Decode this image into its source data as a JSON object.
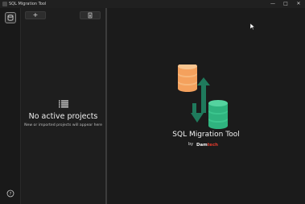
{
  "window": {
    "title": "SQL Migration Tool",
    "controls": {
      "minimize": "—",
      "maximize": "□",
      "close": "✕"
    }
  },
  "rail": {
    "top_icon": "projects-icon",
    "bottom_icon": "help-icon"
  },
  "panel": {
    "add_label": "+",
    "import_icon": "import-icon",
    "empty_icon": "list-icon",
    "empty_title": "No active projects",
    "empty_subtitle": "New or imported projects will appear here"
  },
  "main": {
    "product_name": "SQL Migration Tool",
    "by": "by",
    "brand_part1": "Dam",
    "brand_part2": "tech",
    "colors": {
      "db_top": "#f4a15d",
      "db_bottom": "#2fb37f",
      "arrow": "#1f7a5c",
      "brand_accent": "#e33b2e"
    }
  }
}
